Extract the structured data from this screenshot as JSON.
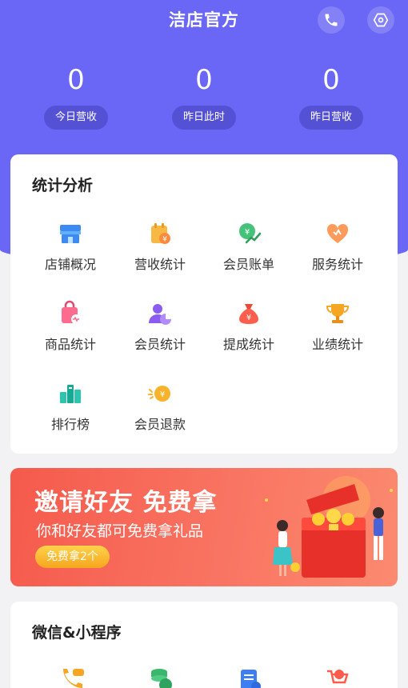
{
  "header": {
    "title": "洁店官方",
    "phone_icon": "phone-icon",
    "settings_icon": "hexagon-settings-icon",
    "accent": "#6a66f6"
  },
  "stats": [
    {
      "value": "0",
      "label": "今日营收"
    },
    {
      "value": "0",
      "label": "昨日此时"
    },
    {
      "value": "0",
      "label": "昨日营收"
    }
  ],
  "analysis": {
    "title": "统计分析",
    "items": [
      {
        "label": "店铺概况",
        "icon": "store-icon"
      },
      {
        "label": "营收统计",
        "icon": "revenue-calendar-icon"
      },
      {
        "label": "会员账单",
        "icon": "member-bill-icon"
      },
      {
        "label": "服务统计",
        "icon": "heart-service-icon"
      },
      {
        "label": "商品统计",
        "icon": "shopping-bag-icon"
      },
      {
        "label": "会员统计",
        "icon": "member-pie-icon"
      },
      {
        "label": "提成统计",
        "icon": "money-bag-icon"
      },
      {
        "label": "业绩统计",
        "icon": "trophy-icon"
      },
      {
        "label": "排行榜",
        "icon": "ranking-bars-icon"
      },
      {
        "label": "会员退款",
        "icon": "refund-coin-icon"
      }
    ]
  },
  "banner": {
    "title": "邀请好友  免费拿",
    "subtitle": "你和好友都可免费拿礼品",
    "button": "免费拿2个"
  },
  "wechat": {
    "title": "微信&小程序",
    "icons": [
      "phone-chat-icon",
      "coin-stack-icon",
      "document-icon",
      "cart-coin-icon"
    ]
  }
}
